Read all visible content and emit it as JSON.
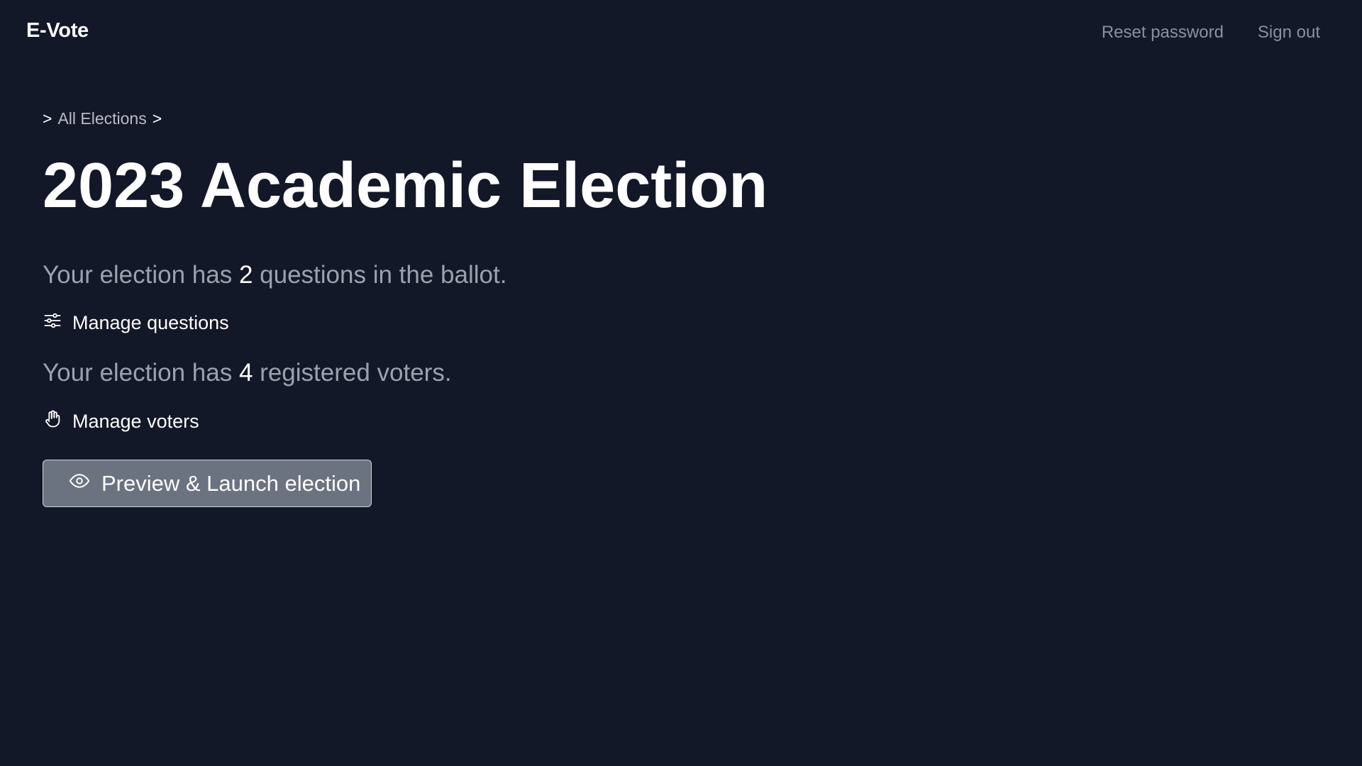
{
  "navbar": {
    "brand": "E-Vote",
    "links": [
      {
        "label": "Reset password"
      },
      {
        "label": "Sign out"
      }
    ]
  },
  "breadcrumb": {
    "prefix": ">",
    "items": [
      {
        "label": "All Elections"
      }
    ],
    "suffix": ">"
  },
  "election": {
    "title": "2023 Academic Election",
    "questions_summary": {
      "before": "Your election has ",
      "count": "2",
      "after": " questions in the ballot."
    },
    "manage_questions": {
      "label": "Manage questions",
      "icon": "sliders-icon"
    },
    "voters_summary": {
      "before": "Your election has ",
      "count": "4",
      "after": " registered voters."
    },
    "manage_voters": {
      "label": "Manage voters",
      "icon": "hand-icon"
    },
    "launch_button": {
      "label": "Preview & Launch election",
      "icon": "eye-icon"
    }
  },
  "colors": {
    "background": "#121827",
    "muted_text": "#9ca2ad",
    "nav_text": "#8a919c",
    "button_bg": "#6b7280"
  }
}
